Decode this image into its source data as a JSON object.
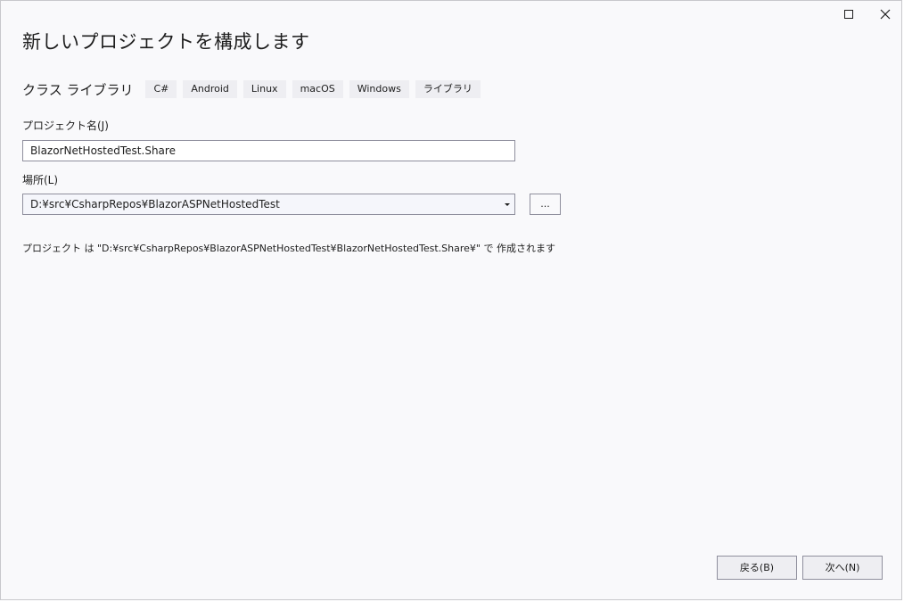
{
  "window": {
    "controls": {
      "maximize_icon": "maximize-icon",
      "close_icon": "close-icon",
      "close_glyph": "✕"
    }
  },
  "header": {
    "title": "新しいプロジェクトを構成します"
  },
  "template": {
    "name": "クラス ライブラリ",
    "tags": [
      "C#",
      "Android",
      "Linux",
      "macOS",
      "Windows",
      "ライブラリ"
    ]
  },
  "form": {
    "project_name": {
      "label": "プロジェクト名(J)",
      "value": "BlazorNetHostedTest.Share"
    },
    "location": {
      "label": "場所(L)",
      "value": "D:¥src¥CsharpRepos¥BlazorASPNetHostedTest",
      "browse_label": "..."
    }
  },
  "info": {
    "text": "プロジェクト は \"D:¥src¥CsharpRepos¥BlazorASPNetHostedTest¥BlazorNetHostedTest.Share¥\" で 作成されます"
  },
  "footer": {
    "back_label": "戻る(B)",
    "next_label": "次へ(N)"
  },
  "colors": {
    "window_bg": "#f9f9fb",
    "input_border": "#8f8f9d",
    "tag_bg": "#eeeef2",
    "button_bg": "#eeeef2",
    "text": "#1e1e1e"
  }
}
